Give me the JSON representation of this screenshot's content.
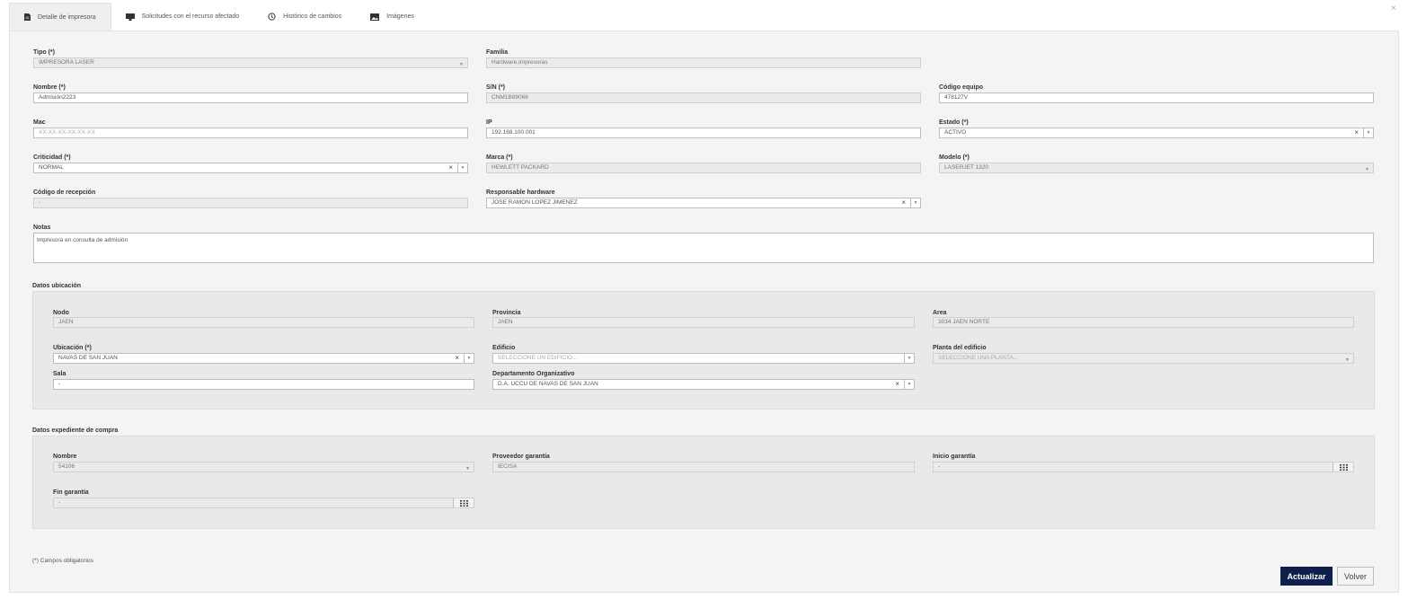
{
  "close_label": "×",
  "tabs": [
    {
      "label": "Detalle de impresora",
      "icon": "document-icon"
    },
    {
      "label": "Solicitudes con el recurso afectado",
      "icon": "monitor-icon"
    },
    {
      "label": "Histórico de cambios",
      "icon": "history-icon"
    },
    {
      "label": "Imágenes",
      "icon": "image-icon"
    }
  ],
  "form": {
    "tipo": {
      "label": "Tipo (*)",
      "value": "IMPRESORA LASER"
    },
    "familia": {
      "label": "Familia",
      "value": "Hardware,Impresoras"
    },
    "nombre": {
      "label": "Nombre (*)",
      "value": "Admisión2223"
    },
    "sn": {
      "label": "S/N (*)",
      "value": "CNM1B89066"
    },
    "codigo_equipo": {
      "label": "Código equipo",
      "value": "478127V"
    },
    "mac": {
      "label": "Mac",
      "placeholder": "XX-XX-XX-XX-XX-XX"
    },
    "ip": {
      "label": "IP",
      "value": "192.168.100.001"
    },
    "estado": {
      "label": "Estado (*)",
      "value": "ACTIVO"
    },
    "criticidad": {
      "label": "Criticidad (*)",
      "value": "NORMAL"
    },
    "marca": {
      "label": "Marca (*)",
      "value": "HEWLETT PACKARD"
    },
    "modelo": {
      "label": "Modelo (*)",
      "value": "LASERJET 1320"
    },
    "codigo_recepcion": {
      "label": "Código de recepción",
      "value": "-"
    },
    "responsable_hardware": {
      "label": "Responsable hardware",
      "value": "JOSE RAMON LOPEZ JIMENEZ"
    },
    "notas": {
      "label": "Notas",
      "value": "Impresora en consulta de admisión"
    }
  },
  "ubicacion": {
    "title": "Datos ubicación",
    "nodo": {
      "label": "Nodo",
      "value": "JAEN"
    },
    "provincia": {
      "label": "Provincia",
      "value": "JAEN"
    },
    "area": {
      "label": "Area",
      "value": "3034 JAEN NORTE"
    },
    "ubicacion": {
      "label": "Ubicación (*)",
      "value": "NAVAS DE SAN JUAN"
    },
    "edificio": {
      "label": "Edificio",
      "placeholder": "SELECCIONE UN EDIFICIO..."
    },
    "planta": {
      "label": "Planta del edificio",
      "placeholder": "SELECCIONE UNA PLANTA..."
    },
    "sala": {
      "label": "Sala",
      "value": "-"
    },
    "departamento": {
      "label": "Departamento Organizativo",
      "value": "D.A. UCCU DE NAVAS DE SAN JUAN"
    }
  },
  "compra": {
    "title": "Datos expediente de compra",
    "nombre": {
      "label": "Nombre",
      "value": "54106"
    },
    "proveedor": {
      "label": "Proveedor garantía",
      "value": "IECISA"
    },
    "inicio": {
      "label": "Inicio garantía",
      "value": "-"
    },
    "fin": {
      "label": "Fin garantía",
      "value": "-"
    }
  },
  "footer": {
    "required_note": "(*) Campos obligatorios",
    "update_label": "Actualizar",
    "back_label": "Volver"
  },
  "colors": {
    "primary_button": "#0c1f4d",
    "panel_bg": "#f4f4f4"
  }
}
